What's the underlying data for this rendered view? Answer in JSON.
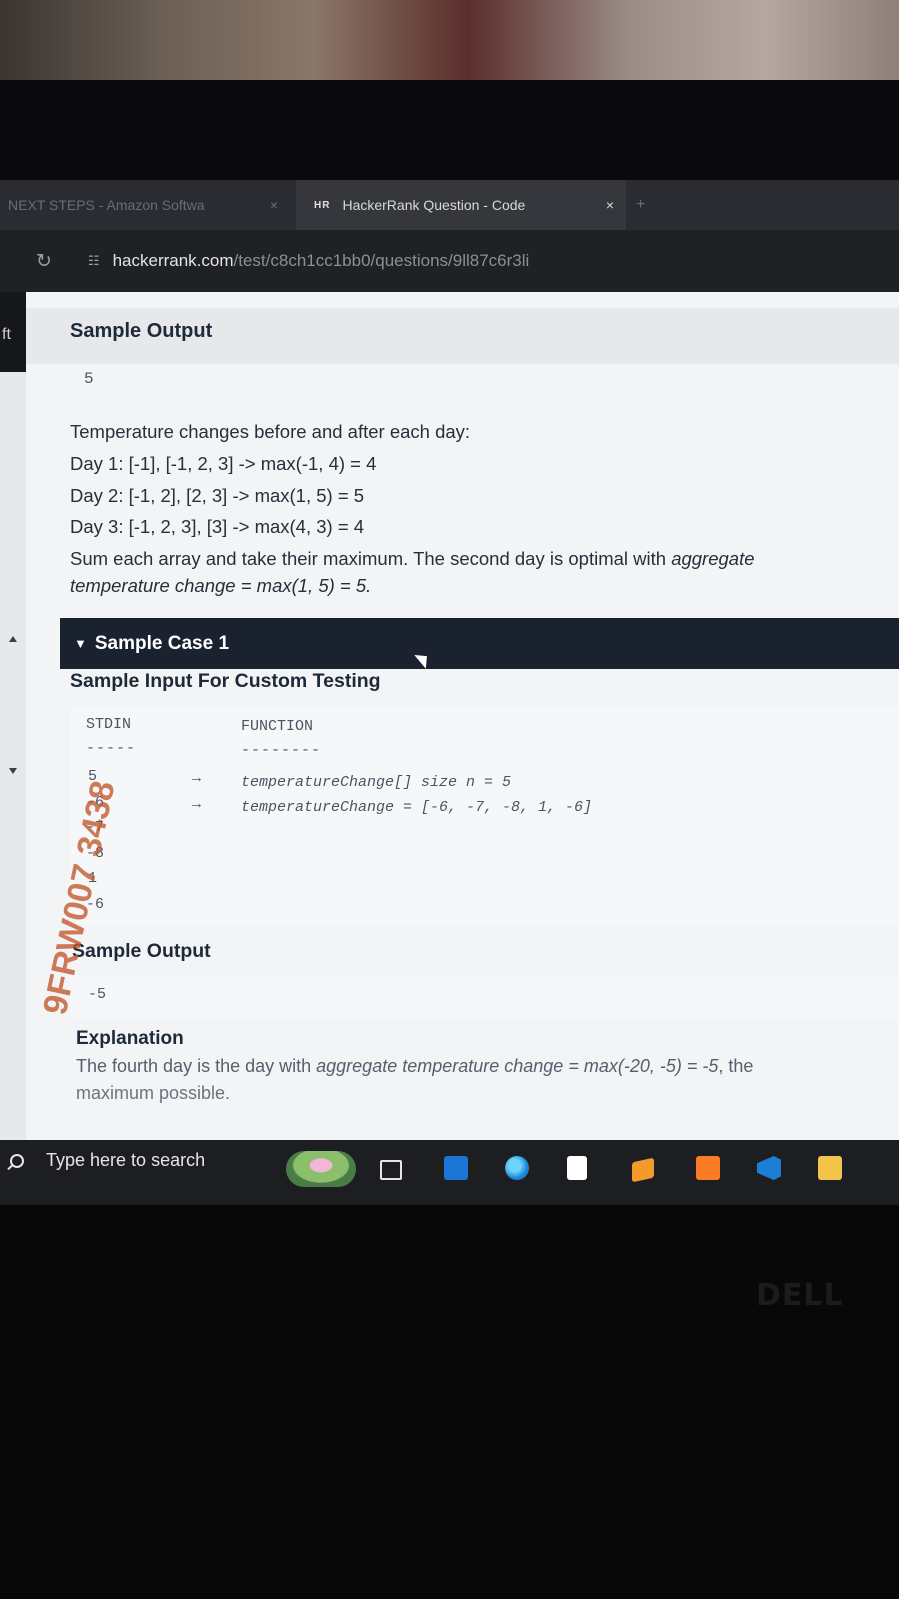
{
  "browser": {
    "inactive_tab_title": "NEXT STEPS - Amazon Softwa",
    "inactive_tab_close": "×",
    "active_tab_icon": "HR",
    "active_tab_title": "HackerRank Question - Code",
    "active_tab_close": "×",
    "new_tab": "+",
    "url_host": "hackerrank.com",
    "url_path": "/test/c8ch1cc1bb0/questions/9ll87c6r3li"
  },
  "sidebar": {
    "collapsed_label": "ft"
  },
  "problem": {
    "sample_output_heading": "Sample Output",
    "sample_output_value": "5",
    "explanation_lines": [
      "Temperature changes before and after each day:",
      "Day 1: [-1], [-1, 2, 3] -> max(-1, 4) = 4",
      "Day 2: [-1, 2], [2, 3] -> max(1, 5) = 5",
      "Day 3: [-1, 2, 3], [3] -> max(4, 3) = 4"
    ],
    "summary_prefix": "Sum each array and take their maximum. The second day is optimal with ",
    "summary_italic_1": "aggregate",
    "summary_italic_2": "temperature change = max(1, 5) = 5.",
    "case_1": {
      "title": "Sample Case 1",
      "input_heading": "Sample Input For Custom Testing",
      "col_stdin": "STDIN",
      "col_function": "FUNCTION",
      "stdin_dashes": "-----",
      "function_dashes": "--------",
      "stdin_values": [
        "5",
        "-6",
        "-7",
        "-8",
        "1",
        "-6"
      ],
      "arrow": "→",
      "function_lines": [
        "temperatureChange[] size n = 5",
        "temperatureChange = [-6, -7, -8, 1, -6]"
      ],
      "output_heading": "Sample Output",
      "output_value": "-5",
      "explanation_heading": "Explanation",
      "explanation_prefix": "The fourth day is the day with ",
      "explanation_italic": "aggregate temperature change = max(-20, -5) = -5",
      "explanation_suffix": ", the",
      "explanation_line2": "maximum possible."
    }
  },
  "taskbar": {
    "search_placeholder": "Type here to search",
    "icons": [
      "task-view-icon",
      "mail-icon",
      "edge-icon",
      "files-icon",
      "sublime-icon",
      "xampp-icon",
      "vscode-icon",
      "file-explorer-icon"
    ]
  },
  "hardware": {
    "brand": "DELL"
  },
  "sticker": {
    "text": "9FRW007 3438"
  }
}
